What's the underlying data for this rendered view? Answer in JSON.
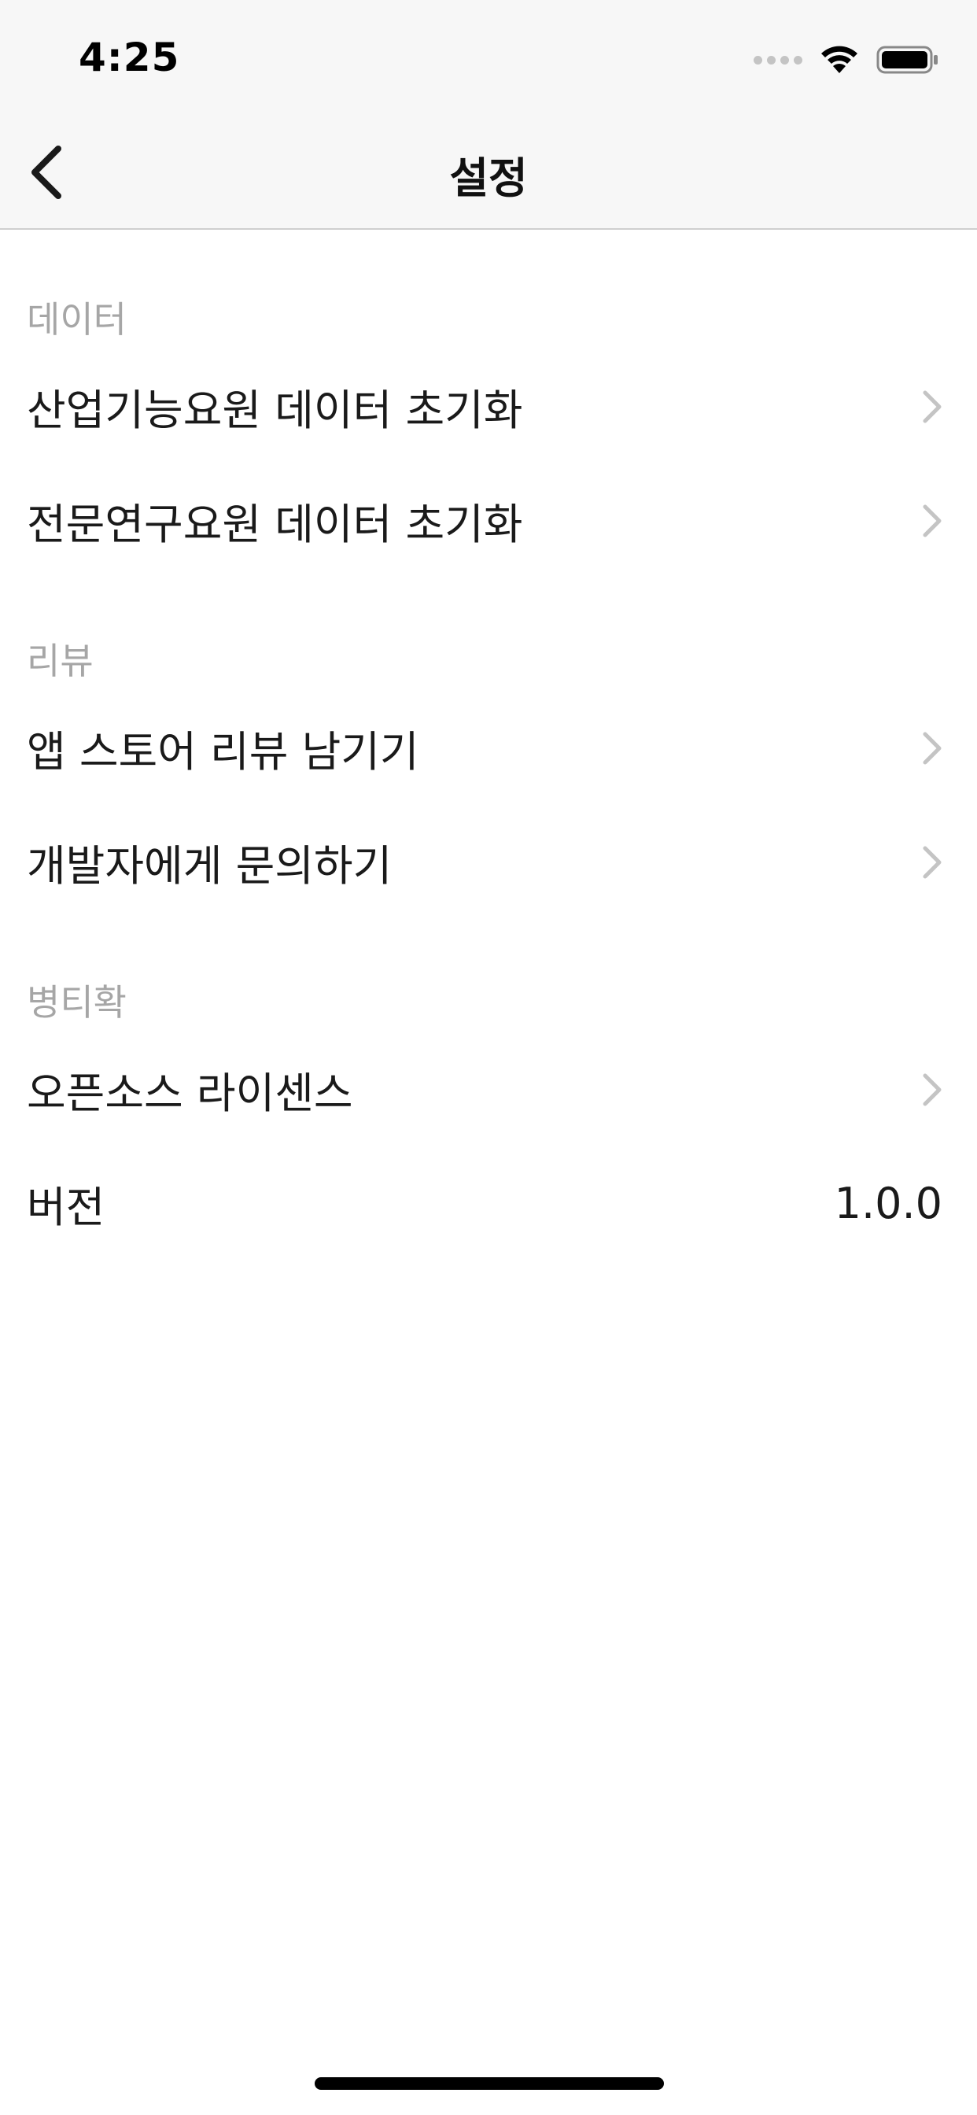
{
  "status_bar": {
    "time": "4:25",
    "icons": [
      "signal-dots-icon",
      "wifi-icon",
      "battery-icon"
    ]
  },
  "nav": {
    "title": "설정",
    "back_icon": "chevron-left-icon"
  },
  "sections": [
    {
      "header": "데이터",
      "rows": [
        {
          "label": "산업기능요원 데이터 초기화",
          "accessory": "chevron-right-icon"
        },
        {
          "label": "전문연구요원 데이터 초기화",
          "accessory": "chevron-right-icon"
        }
      ]
    },
    {
      "header": "리뷰",
      "rows": [
        {
          "label": "앱 스토어 리뷰 남기기",
          "accessory": "chevron-right-icon"
        },
        {
          "label": "개발자에게 문의하기",
          "accessory": "chevron-right-icon"
        }
      ]
    },
    {
      "header": "병티확",
      "rows": [
        {
          "label": "오픈소스 라이센스",
          "accessory": "chevron-right-icon"
        },
        {
          "label": "버전",
          "value": "1.0.0"
        }
      ]
    }
  ],
  "colors": {
    "header_bg": "#f7f7f7",
    "section_header_text": "#a6a6a6",
    "chevron": "#c4c4c4",
    "text": "#1a1a1a"
  }
}
